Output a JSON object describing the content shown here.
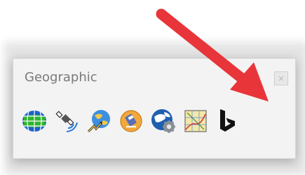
{
  "window": {
    "title": "Geographic",
    "close_label": "×"
  },
  "toolbar": {
    "tools": [
      {
        "icon": "globe-grid-icon"
      },
      {
        "icon": "gps-satellite-icon"
      },
      {
        "icon": "globe-path-icon"
      },
      {
        "icon": "map-pin-scale-icon"
      },
      {
        "icon": "globe-settings-icon"
      },
      {
        "icon": "map-grid-icon"
      },
      {
        "icon": "bing-logo-icon"
      }
    ]
  },
  "annotation": {
    "arrow_color": "#e8353a"
  }
}
